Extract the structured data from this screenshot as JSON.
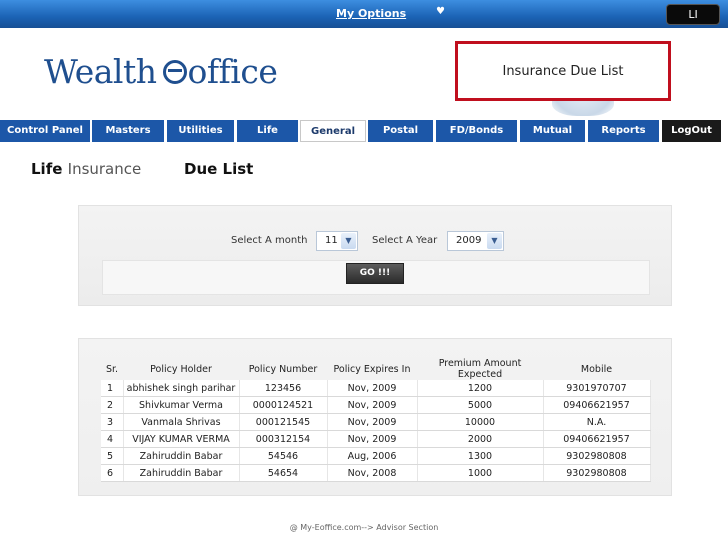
{
  "topbar": {
    "menu_label": "My Options",
    "menu_icon": "heart-icon",
    "slide_number": "LI"
  },
  "logo": {
    "word1": "Wealth",
    "word2": "office"
  },
  "page_title_box": "Insurance Due List",
  "nav": {
    "tabs": [
      {
        "label": "Control Panel"
      },
      {
        "label": "Masters"
      },
      {
        "label": "Utilities"
      },
      {
        "label": "Life"
      },
      {
        "label": "General",
        "active": true
      },
      {
        "label": "Postal"
      },
      {
        "label": "FD/Bonds"
      },
      {
        "label": "Mutual"
      },
      {
        "label": "Reports"
      },
      {
        "label": "LogOut"
      }
    ]
  },
  "heading": {
    "part1": "Life",
    "part2": "Insurance",
    "part3": "Due List"
  },
  "filter": {
    "month_label": "Select A month",
    "month_value": "11",
    "year_label": "Select A Year",
    "year_value": "2009",
    "go_label": "GO !!!"
  },
  "table": {
    "headers": [
      "Sr.",
      "Policy Holder",
      "Policy Number",
      "Policy Expires In",
      "Premium Amount Expected",
      "Mobile"
    ],
    "rows": [
      [
        "1",
        "abhishek singh parihar",
        "123456",
        "Nov, 2009",
        "1200",
        "9301970707"
      ],
      [
        "2",
        "Shivkumar Verma",
        "0000124521",
        "Nov, 2009",
        "5000",
        "09406621957"
      ],
      [
        "3",
        "Vanmala Shrivas",
        "000121545",
        "Nov, 2009",
        "10000",
        "N.A."
      ],
      [
        "4",
        "VIJAY KUMAR VERMA",
        "000312154",
        "Nov, 2009",
        "2000",
        "09406621957"
      ],
      [
        "5",
        "Zahiruddin Babar",
        "54546",
        "Aug, 2006",
        "1300",
        "9302980808"
      ],
      [
        "6",
        "Zahiruddin Babar",
        "54654",
        "Nov, 2008",
        "1000",
        "9302980808"
      ]
    ]
  },
  "footer": "@ My-Eoffice.com--> Advisor Section",
  "colors": {
    "nav_blue": "#1c57a8",
    "title_border": "#c00f1e",
    "logo_blue": "#1f4f8f"
  }
}
